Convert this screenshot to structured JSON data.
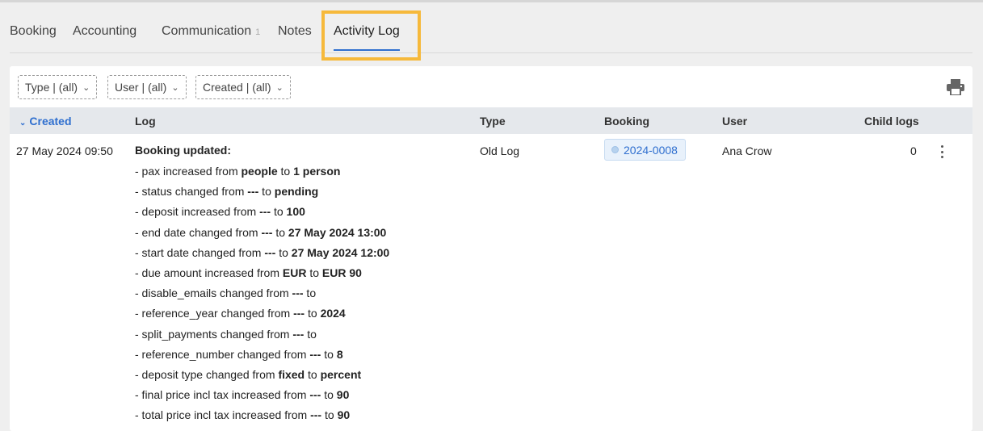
{
  "tabs": [
    {
      "label": "Booking"
    },
    {
      "label": "Accounting"
    },
    {
      "label": "Communication",
      "count": "1"
    },
    {
      "label": "Notes"
    },
    {
      "label": "Activity Log",
      "active": true
    }
  ],
  "filters": [
    {
      "label": "Type | (all)"
    },
    {
      "label": "User | (all)"
    },
    {
      "label": "Created | (all)"
    }
  ],
  "toolbar": {
    "print_icon": "printer-icon"
  },
  "table": {
    "columns": {
      "created": "Created",
      "log": "Log",
      "type": "Type",
      "booking": "Booking",
      "user": "User",
      "child_logs": "Child logs"
    },
    "sort_icon": "chevron-down-icon",
    "rows": [
      {
        "created": "27 May 2024 09:50",
        "log_title": "Booking updated:",
        "log_lines": [
          {
            "prefix": "- pax increased from ",
            "from": "people",
            "mid": " to ",
            "to": "1 person"
          },
          {
            "prefix": "- status changed from ",
            "from": "---",
            "mid": " to ",
            "to": "pending"
          },
          {
            "prefix": "- deposit increased from ",
            "from": "---",
            "mid": " to ",
            "to": "100"
          },
          {
            "prefix": "- end date changed from ",
            "from": "---",
            "mid": " to ",
            "to": "27 May 2024 13:00"
          },
          {
            "prefix": "- start date changed from ",
            "from": "---",
            "mid": " to ",
            "to": "27 May 2024 12:00"
          },
          {
            "prefix": "- due amount increased from ",
            "from": "EUR",
            "mid": " to ",
            "to": "EUR 90"
          },
          {
            "prefix": "- disable_emails changed from ",
            "from": "---",
            "mid": " to",
            "to": ""
          },
          {
            "prefix": "- reference_year changed from ",
            "from": "---",
            "mid": " to ",
            "to": "2024"
          },
          {
            "prefix": "- split_payments changed from ",
            "from": "---",
            "mid": " to",
            "to": ""
          },
          {
            "prefix": "- reference_number changed from ",
            "from": "---",
            "mid": " to ",
            "to": "8"
          },
          {
            "prefix": "- deposit type changed from ",
            "from": "fixed",
            "mid": " to ",
            "to": "percent"
          },
          {
            "prefix": "- final price incl tax increased from ",
            "from": "---",
            "mid": " to ",
            "to": "90"
          },
          {
            "prefix": "- total price incl tax increased from ",
            "from": "---",
            "mid": " to ",
            "to": "90"
          }
        ],
        "type": "Old Log",
        "booking": "2024-0008",
        "user": "Ana Crow",
        "child_logs": "0",
        "actions_icon": "more-vertical-icon"
      }
    ]
  },
  "colors": {
    "accent": "#2f6fcf",
    "highlight": "#f6b93b",
    "header_bg": "#e5e8ec"
  }
}
